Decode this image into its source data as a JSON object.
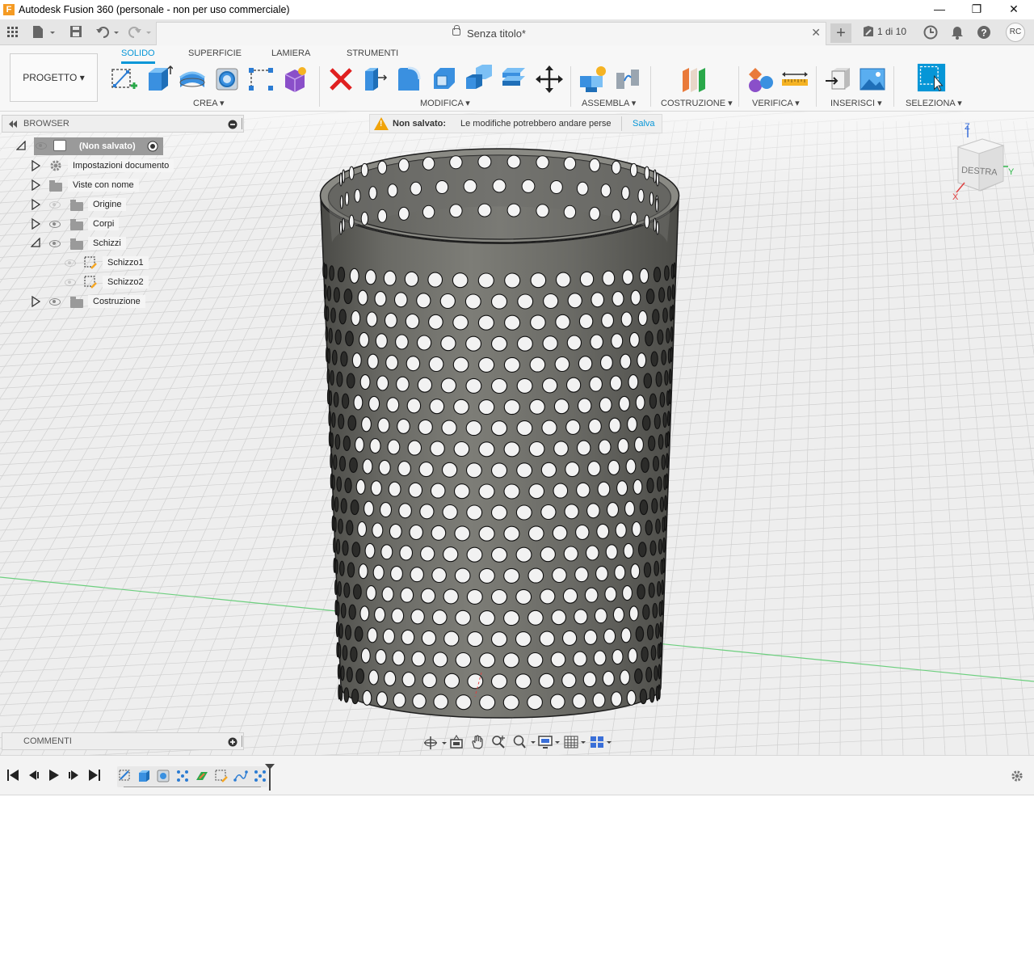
{
  "window": {
    "title": "Autodesk Fusion 360 (personale - non per uso commerciale)",
    "minimize": "—",
    "restore": "❐",
    "close": "✕"
  },
  "tabs": {
    "document_name": "Senza titolo*",
    "close": "✕",
    "new_tab": "+",
    "jobs": "1 di 10",
    "user_initials": "RC"
  },
  "ribbon": {
    "workspace": "PROGETTO ▾",
    "tabs": [
      "SOLIDO",
      "SUPERFICIE",
      "LAMIERA",
      "STRUMENTI"
    ],
    "active_tab": "SOLIDO",
    "groups": [
      "CREA ▾",
      "MODIFICA ▾",
      "ASSEMBLA ▾",
      "COSTRUZIONE ▾",
      "VERIFICA ▾",
      "INSERISCI ▾",
      "SELEZIONA ▾"
    ],
    "accent": "#0696d7"
  },
  "browser": {
    "title": "BROWSER",
    "root": "(Non salvato)",
    "items": [
      "Impostazioni documento",
      "Viste con nome",
      "Origine",
      "Corpi",
      "Schizzi",
      "Schizzo1",
      "Schizzo2",
      "Costruzione"
    ]
  },
  "notice": {
    "label": "Non salvato:",
    "message": "Le modifiche potrebbero andare perse",
    "action": "Salva"
  },
  "viewcube": {
    "face": "DESTRA",
    "axis_z": "Z",
    "axis_y": "Y",
    "axis_x": "X"
  },
  "comments": {
    "title": "COMMENTI"
  },
  "colors": {
    "model": "#6b6b66",
    "warning": "#f0a30a",
    "x_axis": "#e04040",
    "y_axis": "#2fb84a",
    "z_axis": "#3a6fd8"
  }
}
